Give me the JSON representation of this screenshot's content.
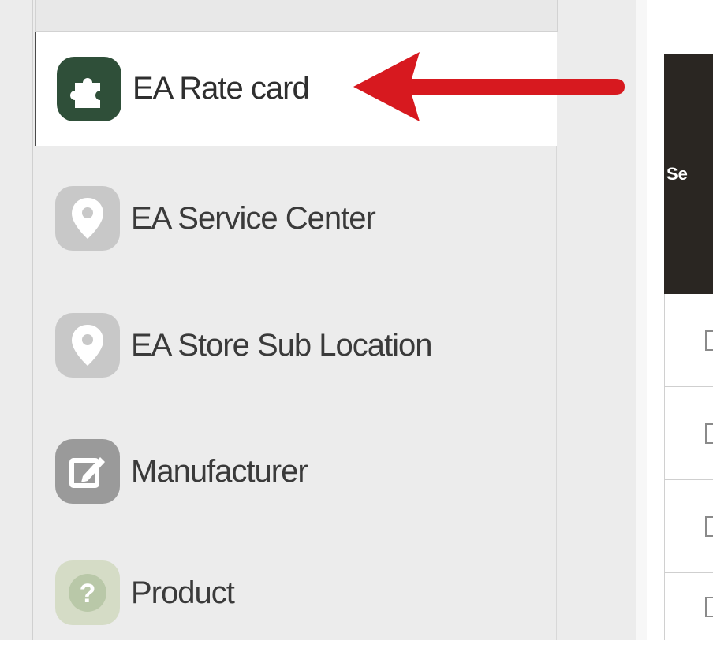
{
  "sidebar": {
    "items": [
      {
        "label": "EA Rate card",
        "icon": "puzzle-icon",
        "active": true,
        "icon_color": "#2f4f39"
      },
      {
        "label": "EA Service Center",
        "icon": "map-pin-icon",
        "active": false,
        "icon_color": "#c4c4c4"
      },
      {
        "label": "EA Store Sub Location",
        "icon": "map-pin-icon",
        "active": false,
        "icon_color": "#c4c4c4"
      },
      {
        "label": "Manufacturer",
        "icon": "edit-icon",
        "active": false,
        "icon_color": "#9a9a9a"
      },
      {
        "label": "Product",
        "icon": "question-icon",
        "active": false,
        "icon_color": "#b9c8a8"
      }
    ]
  },
  "annotation": {
    "arrow_color": "#d7191f"
  },
  "table": {
    "header_label": "Se",
    "header_bg": "#2a2622",
    "rows": [
      {},
      {},
      {},
      {}
    ]
  }
}
